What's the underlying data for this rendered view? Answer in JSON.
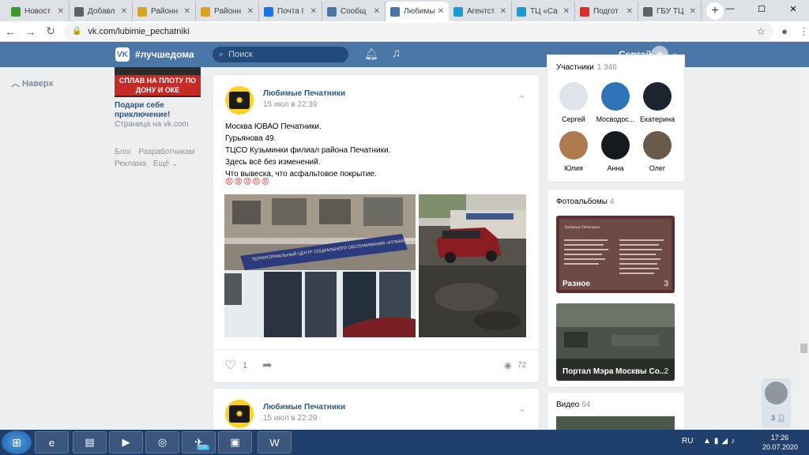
{
  "browser": {
    "tabs": [
      {
        "label": "Новост",
        "color": "#3c9a2f"
      },
      {
        "label": "Добавл",
        "color": "#5f6368"
      },
      {
        "label": "Районн",
        "color": "#d9a31f"
      },
      {
        "label": "Районн",
        "color": "#d9a31f"
      },
      {
        "label": "Почта I",
        "color": "#1a73e8"
      },
      {
        "label": "Сообщ",
        "color": "#4a76a8"
      },
      {
        "label": "Любимы",
        "color": "#4a76a8",
        "active": true
      },
      {
        "label": "Агентст",
        "color": "#1d9bd1"
      },
      {
        "label": "ТЦ «Са",
        "color": "#1d9bd1"
      },
      {
        "label": "Подгот",
        "color": "#d93025"
      },
      {
        "label": "ГБУ ТЦ",
        "color": "#5f6368"
      }
    ],
    "url": "vk.com/lubimie_pechatniki"
  },
  "vk_header": {
    "logo": "VK",
    "hashtag": "#лучшедома",
    "search_placeholder": "Поиск",
    "username": "Сергей"
  },
  "left": {
    "back": "Наверх",
    "ad_image_text": "СПЛАВ НА ПЛОТУ ПО ДОНУ И ОКЕ",
    "ad_title": "Подари себе приключение!",
    "ad_site": "Страница на vk.com",
    "footer_links": [
      "Блог",
      "Разработчикам",
      "Реклама",
      "Ещё ⌄"
    ]
  },
  "post1": {
    "author": "Любимые Печатники",
    "date": "15 июл в 22:39",
    "lines": [
      "Москва ЮВАО Печатники.",
      "Гурьянова 49.",
      "ТЦСО Кузьминки филиал района Печатники.",
      "Здесь всё без изменений.",
      "Что вывеска, что асфальтовое покрытие."
    ],
    "emojis": "😡😡😡😡😡",
    "sign_text": "ТЕРРИТОРИАЛЬНЫЙ ЦЕНТР СОЦИАЛЬНОГО ОБСЛУЖИВАНИЯ «КУЗЬМИНКИ»",
    "likes": "1",
    "views": "72"
  },
  "post2": {
    "author": "Любимые Печатники",
    "date": "15 июл в 22:29"
  },
  "members": {
    "title": "Участники",
    "count": "1 346",
    "people": [
      {
        "name": "Сергей",
        "color": "#dfe4ea"
      },
      {
        "name": "Мосводос...",
        "color": "#2e72b8"
      },
      {
        "name": "Екатерина",
        "color": "#1c2430"
      },
      {
        "name": "Юлия",
        "color": "#b07a4f"
      },
      {
        "name": "Анна",
        "color": "#16191e"
      },
      {
        "name": "Олег",
        "color": "#6a5a4a"
      }
    ]
  },
  "albums": {
    "title": "Фотоальбомы",
    "count": "4",
    "items": [
      {
        "title": "Разное",
        "count": "3"
      },
      {
        "title": "Портал Мэра Москвы Со...",
        "count": "2"
      }
    ],
    "album1_heading": "Любимые Печатники"
  },
  "videos": {
    "title": "Видео",
    "count": "64"
  },
  "chat": {
    "count": "3"
  },
  "taskbar": {
    "lang": "RU",
    "time": "17:26",
    "date": "20.07.2020",
    "telegram_badge": "938"
  }
}
